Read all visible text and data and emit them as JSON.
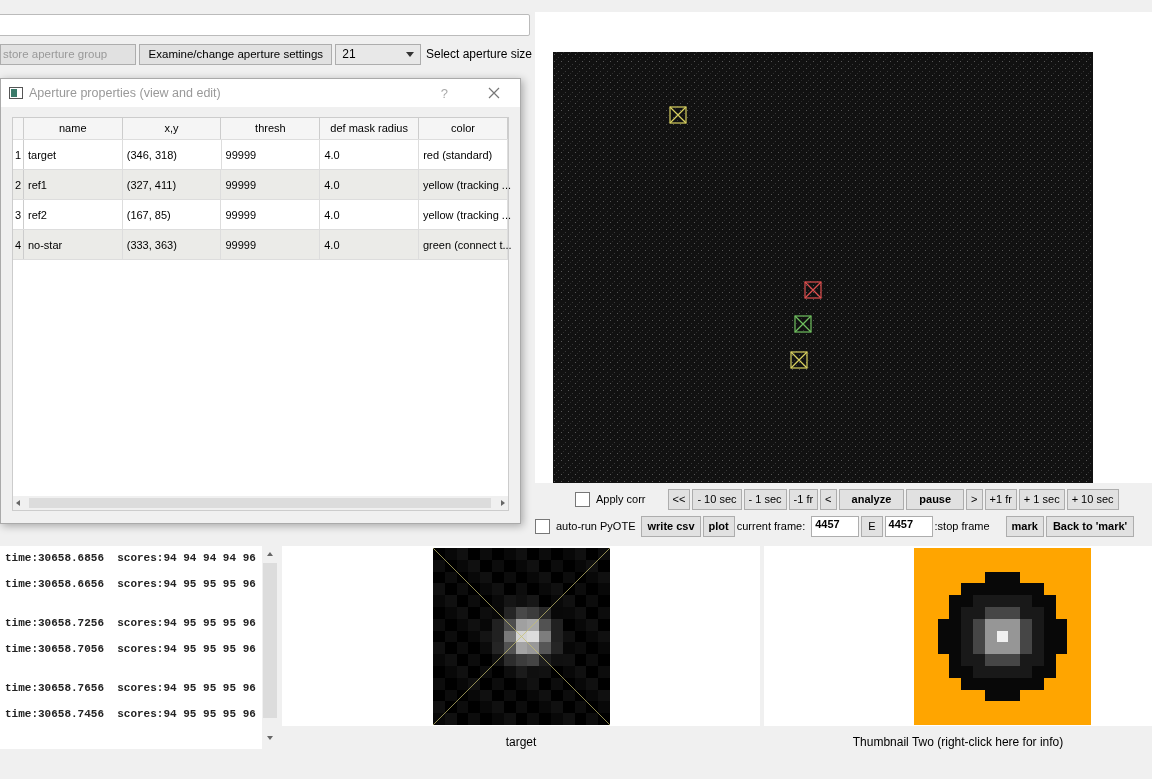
{
  "aperture_controls": {
    "store_button": {
      "label": "store aperture group",
      "disabled": true
    },
    "examine_button": "Examine/change aperture settings",
    "size_dropdown": {
      "value": "21"
    },
    "size_label": "Select aperture size"
  },
  "dialog": {
    "title": "Aperture properties (view and edit)",
    "help": "?",
    "columns": [
      "name",
      "x,y",
      "thresh",
      "def mask radius",
      "color"
    ],
    "rows": [
      {
        "index": "1",
        "cells": [
          "target",
          "(346, 318)",
          "99999",
          "4.0",
          "red (standard)"
        ]
      },
      {
        "index": "2",
        "cells": [
          "ref1",
          "(327, 411)",
          "99999",
          "4.0",
          "yellow (tracking ..."
        ]
      },
      {
        "index": "3",
        "cells": [
          "ref2",
          "(167, 85)",
          "99999",
          "4.0",
          "yellow (tracking ..."
        ]
      },
      {
        "index": "4",
        "cells": [
          "no-star",
          "(333, 363)",
          "99999",
          "4.0",
          "green (connect t..."
        ]
      }
    ]
  },
  "playback": {
    "apply_corr": {
      "label": "Apply corr",
      "checked": false
    },
    "buttons": [
      {
        "label": "<<",
        "bold": false
      },
      {
        "label": "- 10 sec",
        "bold": false
      },
      {
        "label": "- 1 sec",
        "bold": false
      },
      {
        "label": "-1 fr",
        "bold": false
      },
      {
        "label": "<",
        "bold": false
      },
      {
        "label": "analyze",
        "bold": true
      },
      {
        "label": "pause",
        "bold": true
      },
      {
        "label": ">",
        "bold": false
      },
      {
        "label": "+1 fr",
        "bold": false
      },
      {
        "label": "+ 1 sec",
        "bold": false
      },
      {
        "label": "+ 10 sec",
        "bold": false
      }
    ]
  },
  "frame_controls": {
    "auto_run": {
      "label": "auto-run PyOTE",
      "checked": false
    },
    "write_csv": "write csv",
    "plot": "plot",
    "current_frame_label": "current frame:",
    "current_frame": "4457",
    "e_button": "E",
    "stop_frame": "4457",
    "stop_frame_label": ":stop frame",
    "mark": "mark",
    "back": "Back to 'mark'"
  },
  "log": {
    "groups": [
      {
        "lines": [
          "time:30658.6856  scores:94 94 94 94 96",
          "time:30658.6656  scores:94 95 95 95 96"
        ]
      },
      {
        "lines": [
          "time:30658.7256  scores:94 95 95 95 96",
          "time:30658.7056  scores:94 95 95 95 96"
        ]
      },
      {
        "lines": [
          "time:30658.7656  scores:94 95 95 95 96",
          "time:30658.7456  scores:94 95 95 95 96"
        ]
      }
    ]
  },
  "thumbnails": [
    {
      "kind": "aperture",
      "caption": "target"
    },
    {
      "kind": "mask",
      "caption": "Thumbnail Two (right-click here for info)"
    }
  ]
}
